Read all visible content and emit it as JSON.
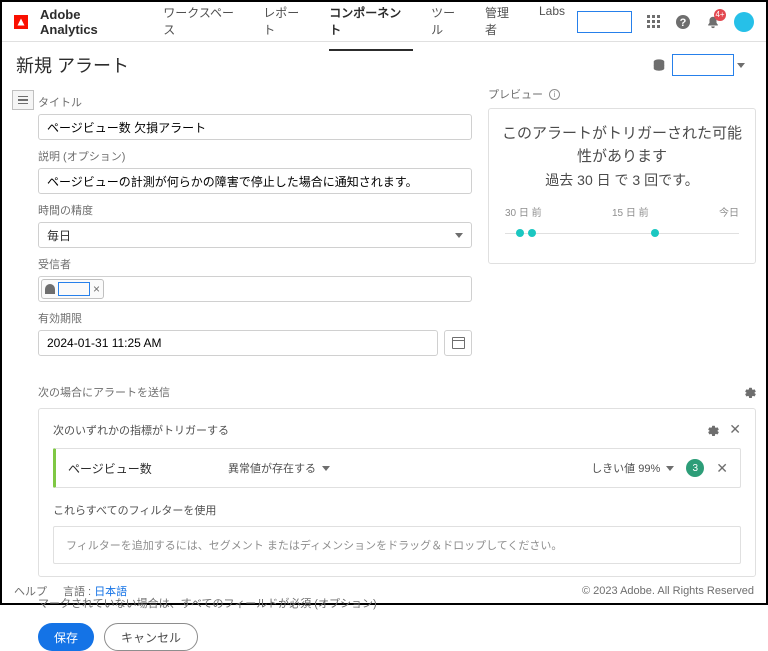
{
  "brand": "Adobe Analytics",
  "nav": {
    "workspace": "ワークスペース",
    "reports": "レポート",
    "components": "コンポーネント",
    "tools": "ツール",
    "admin": "管理者",
    "labs": "Labs"
  },
  "bell_count": "4+",
  "page_title": "新規 アラート",
  "form": {
    "title_label": "タイトル",
    "title_value": "ページビュー数 欠損アラート",
    "desc_label": "説明 (オプション)",
    "desc_value": "ページビューの計測が何らかの障害で停止した場合に通知されます。",
    "granularity_label": "時間の精度",
    "granularity_value": "毎日",
    "recipient_label": "受信者",
    "expiry_label": "有効期限",
    "expiry_value": "2024-01-31 11:25 AM"
  },
  "preview": {
    "label": "プレビュー",
    "title": "このアラートがトリガーされた可能性があります",
    "subtitle": "過去 30 日 で 3 回です。",
    "timeline": {
      "start": "30 日 前",
      "mid": "15 日 前",
      "end": "今日"
    }
  },
  "alert_section": {
    "header": "次の場合にアラートを送信",
    "trigger_header": "次のいずれかの指標がトリガーする",
    "metric": {
      "name": "ページビュー数",
      "condition": "異常値が存在する",
      "threshold": "しきい値 99%",
      "count": "3"
    },
    "filter_label": "これらすべてのフィルターを使用",
    "drop_hint": "フィルターを追加するには、セグメント またはディメンションをドラッグ＆ドロップしてください。"
  },
  "required_note": "マークされていない場合は、すべてのフィールドが必須 (オプション)",
  "buttons": {
    "save": "保存",
    "cancel": "キャンセル"
  },
  "footer": {
    "help": "ヘルプ",
    "lang_label": "言語 :",
    "lang_value": "日本語",
    "copyright": "© 2023 Adobe. All Rights Reserved"
  }
}
